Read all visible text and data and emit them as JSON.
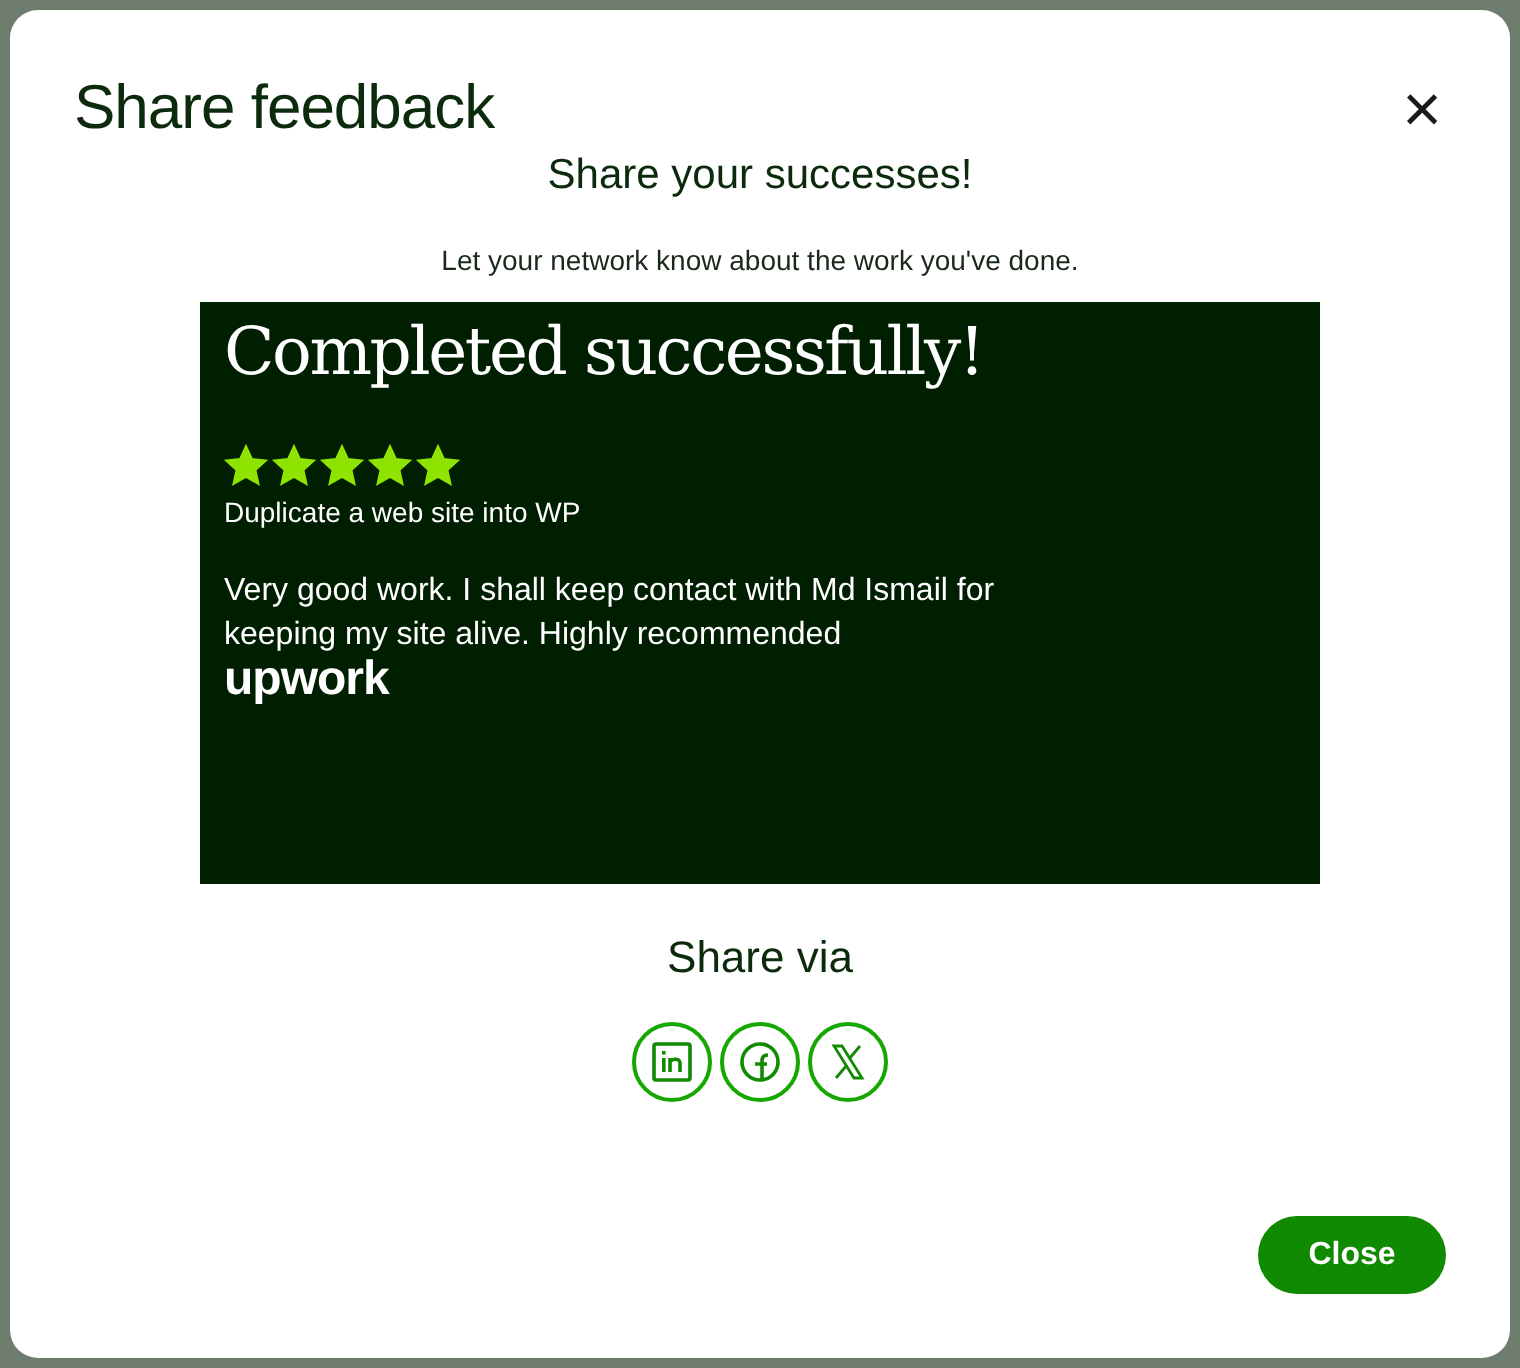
{
  "dialog": {
    "title": "Share feedback",
    "close_icon": "×"
  },
  "heading": "Share your successes!",
  "subheading": "Let your network know about the work you've done.",
  "feedback_card": {
    "title": "Completed successfully!",
    "stars": 5,
    "job": "Duplicate a web site into WP",
    "comment": "Very good work. I shall keep contact with Md Ismail for keeping my site alive. Highly recommended",
    "logo": "upwork"
  },
  "share": {
    "label": "Share via",
    "buttons": [
      {
        "kind": "in"
      },
      {
        "kind": "f"
      },
      {
        "kind": "x"
      }
    ]
  },
  "buttons": [
    "Close"
  ]
}
